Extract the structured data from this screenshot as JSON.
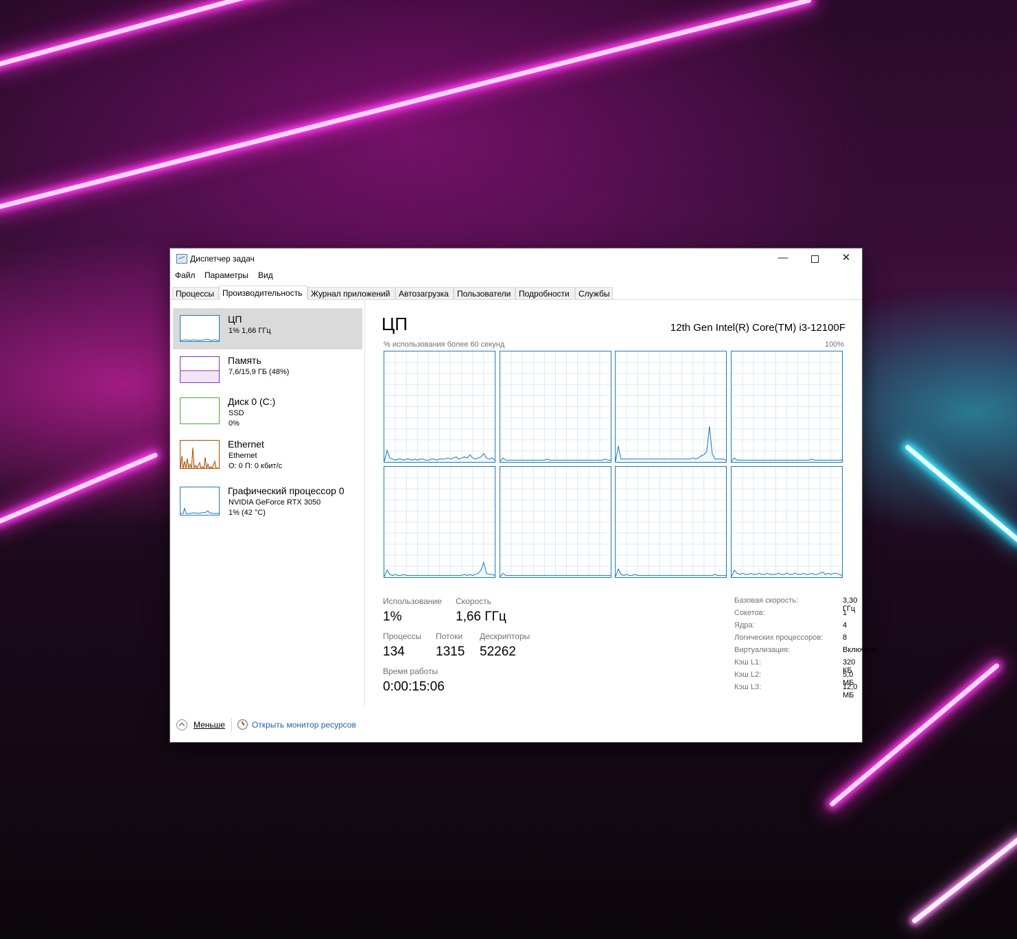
{
  "window": {
    "title": "Диспетчер задач",
    "buttons": {
      "minimize": "—",
      "close": "✕"
    }
  },
  "menu": [
    "Файл",
    "Параметры",
    "Вид"
  ],
  "tabs": [
    "Процессы",
    "Производительность",
    "Журнал приложений",
    "Автозагрузка",
    "Пользователи",
    "Подробности",
    "Службы"
  ],
  "active_tab": "Производительность",
  "sidebar": {
    "items": [
      {
        "title": "ЦП",
        "line1": "1% 1,66 ГГц",
        "line2": "",
        "color": "#1a7ab6",
        "selected": true
      },
      {
        "title": "Память",
        "line1": "7,6/15,9 ГБ (48%)",
        "line2": "",
        "color": "#8b2fb5",
        "usage": 0.48
      },
      {
        "title": "Диск 0 (C:)",
        "line1": "SSD",
        "line2": "0%",
        "color": "#4ea72e"
      },
      {
        "title": "Ethernet",
        "line1": "Ethernet",
        "line2": "О: 0 П: 0 кбит/с",
        "color": "#a74f01"
      },
      {
        "title": "Графический процессор 0",
        "line1": "NVIDIA GeForce RTX 3050",
        "line2": "1% (42 °C)",
        "color": "#1a7ab6"
      }
    ]
  },
  "main": {
    "title": "ЦП",
    "model": "12th Gen Intel(R) Core(TM) i3-12100F",
    "graph_label": "% использования более 60 секунд",
    "graph_max": "100%",
    "stats": {
      "usage_label": "Использование",
      "usage": "1%",
      "speed_label": "Скорость",
      "speed": "1,66 ГГц",
      "processes_label": "Процессы",
      "processes": "134",
      "threads_label": "Потоки",
      "threads": "1315",
      "handles_label": "Дескрипторы",
      "handles": "52262",
      "uptime_label": "Время работы",
      "uptime": "0:00:15:06"
    },
    "specs": [
      {
        "key": "Базовая скорость:",
        "value": "3,30 ГГц"
      },
      {
        "key": "Сокетов:",
        "value": "1"
      },
      {
        "key": "Ядра:",
        "value": "4"
      },
      {
        "key": "Логических процессоров:",
        "value": "8"
      },
      {
        "key": "Виртуализация:",
        "value": "Включено"
      },
      {
        "key": "Кэш L1:",
        "value": "320 КБ"
      },
      {
        "key": "Кэш L2:",
        "value": "5,0 МБ"
      },
      {
        "key": "Кэш L3:",
        "value": "12,0 МБ"
      }
    ]
  },
  "footer": {
    "less": "Меньше",
    "resource_monitor": "Открыть монитор ресурсов"
  },
  "chart_data": {
    "type": "line",
    "title": "% использования более 60 секунд",
    "ylim": [
      0,
      100
    ],
    "series": [
      {
        "values": [
          0,
          10,
          3,
          2,
          1,
          2,
          2,
          1,
          2,
          2,
          1,
          2,
          1,
          2,
          2,
          1,
          1,
          2,
          2,
          1,
          2,
          2,
          2,
          3,
          2,
          3,
          4,
          2,
          3,
          4,
          3,
          6,
          3,
          2,
          3,
          4,
          7,
          3,
          2,
          3,
          1
        ]
      },
      {
        "values": [
          0,
          3,
          1,
          1,
          1,
          1,
          1,
          1,
          1,
          1,
          1,
          1,
          1,
          1,
          1,
          1,
          1,
          2,
          1,
          1,
          1,
          1,
          1,
          1,
          1,
          1,
          1,
          1,
          1,
          1,
          1,
          1,
          1,
          1,
          1,
          1,
          1,
          1,
          2,
          1,
          1
        ]
      },
      {
        "values": [
          0,
          14,
          2,
          2,
          2,
          2,
          2,
          2,
          2,
          2,
          2,
          2,
          2,
          2,
          2,
          2,
          2,
          2,
          2,
          2,
          2,
          2,
          2,
          2,
          2,
          2,
          2,
          2,
          3,
          2,
          3,
          5,
          6,
          9,
          32,
          7,
          2,
          2,
          2,
          2,
          1
        ]
      },
      {
        "values": [
          0,
          3,
          1,
          1,
          1,
          1,
          1,
          1,
          1,
          1,
          1,
          1,
          1,
          1,
          1,
          1,
          1,
          1,
          1,
          1,
          1,
          1,
          1,
          1,
          1,
          1,
          1,
          1,
          1,
          2,
          1,
          1,
          1,
          1,
          1,
          1,
          1,
          1,
          1,
          1,
          1
        ]
      },
      {
        "values": [
          0,
          6,
          2,
          1,
          2,
          1,
          1,
          2,
          1,
          1,
          1,
          1,
          1,
          1,
          1,
          1,
          1,
          1,
          1,
          1,
          1,
          1,
          1,
          1,
          1,
          1,
          1,
          1,
          1,
          2,
          1,
          2,
          1,
          2,
          3,
          6,
          13,
          3,
          2,
          2,
          1
        ]
      },
      {
        "values": [
          0,
          3,
          1,
          1,
          1,
          1,
          1,
          1,
          1,
          1,
          1,
          1,
          1,
          1,
          1,
          1,
          1,
          1,
          1,
          1,
          1,
          1,
          1,
          1,
          1,
          1,
          1,
          1,
          1,
          1,
          1,
          1,
          1,
          1,
          1,
          1,
          1,
          1,
          1,
          1,
          1
        ]
      },
      {
        "values": [
          0,
          7,
          2,
          1,
          2,
          1,
          1,
          2,
          1,
          1,
          1,
          1,
          1,
          1,
          1,
          1,
          1,
          1,
          1,
          1,
          1,
          1,
          1,
          1,
          1,
          1,
          1,
          1,
          1,
          1,
          1,
          1,
          1,
          1,
          1,
          1,
          2,
          1,
          1,
          1,
          1
        ]
      },
      {
        "values": [
          0,
          6,
          3,
          2,
          3,
          2,
          2,
          3,
          2,
          2,
          3,
          2,
          2,
          3,
          2,
          2,
          2,
          3,
          2,
          2,
          3,
          2,
          2,
          3,
          2,
          2,
          3,
          2,
          2,
          3,
          2,
          2,
          3,
          4,
          2,
          3,
          2,
          3,
          3,
          2,
          1
        ]
      }
    ]
  }
}
